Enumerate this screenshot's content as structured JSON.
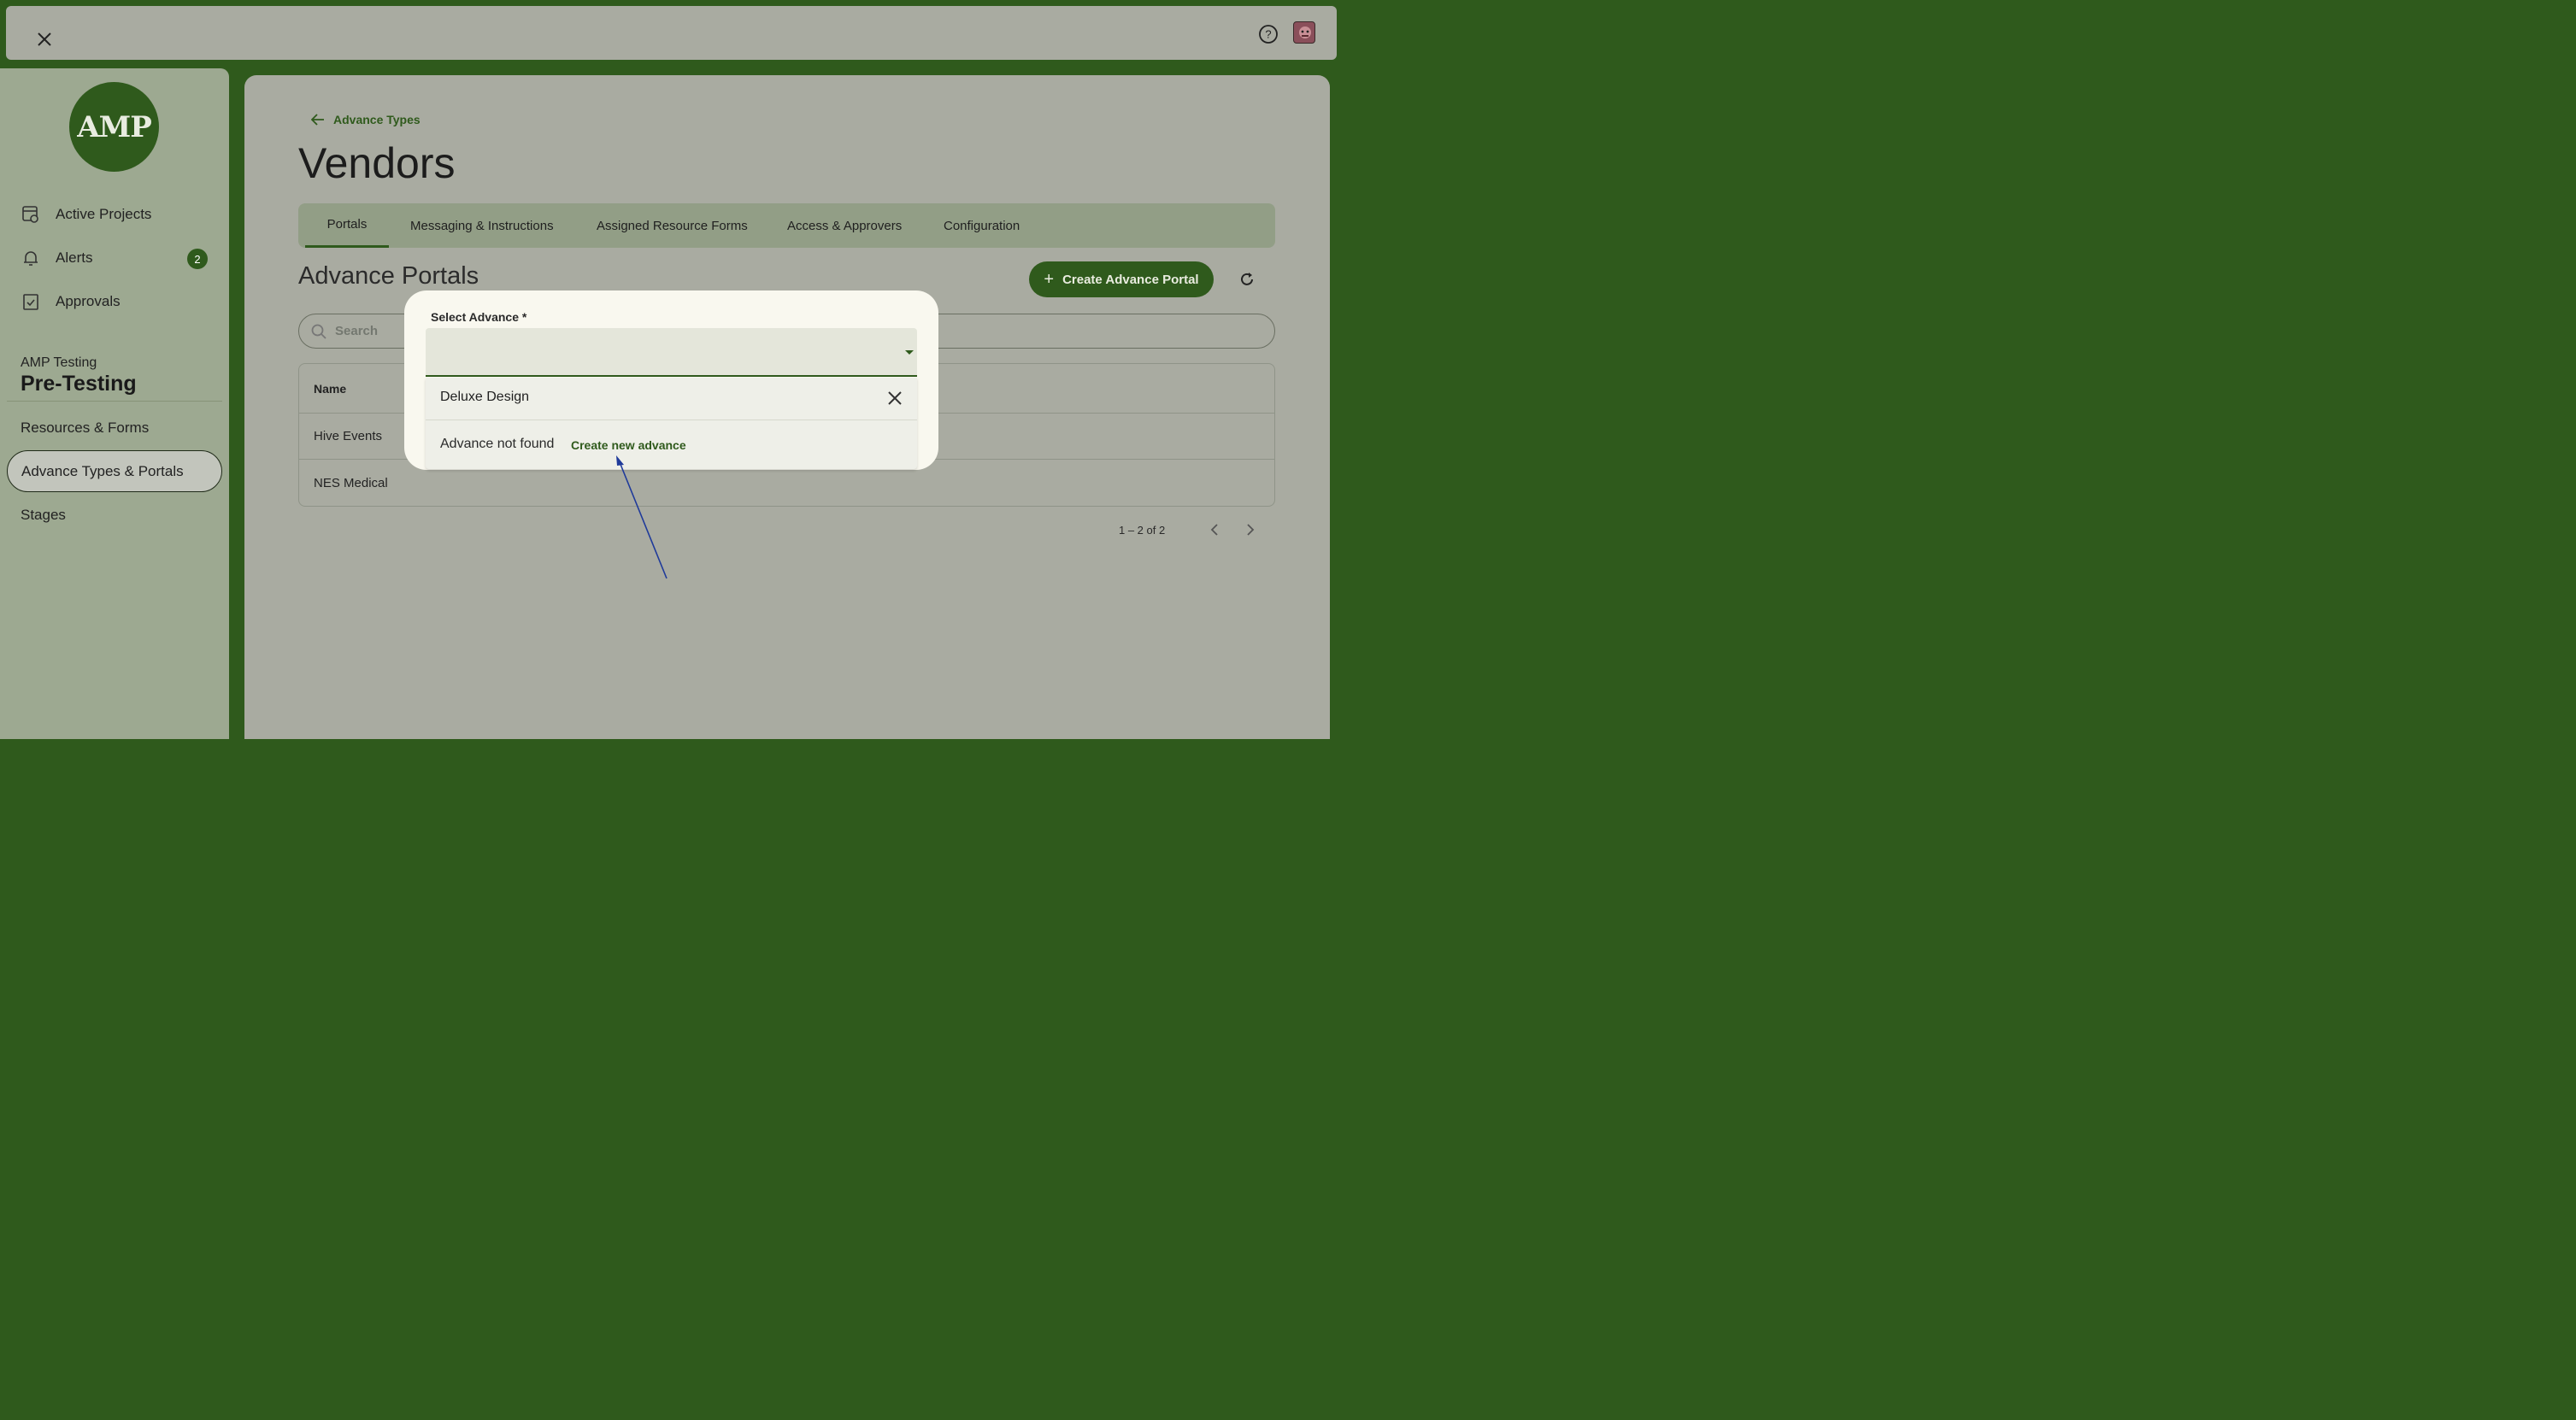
{
  "sidebar": {
    "logo_text": "AMP",
    "nav": [
      {
        "label": "Active Projects",
        "icon": "projects-icon"
      },
      {
        "label": "Alerts",
        "icon": "bell-icon",
        "badge": "2"
      },
      {
        "label": "Approvals",
        "icon": "clipboard-check-icon"
      }
    ],
    "org_small": "AMP Testing",
    "org_big": "Pre-Testing",
    "sub_items": [
      "Resources & Forms",
      "Advance Types & Portals",
      "Stages"
    ]
  },
  "main": {
    "back_label": "Advance Types",
    "title": "Vendors",
    "tabs": [
      "Portals",
      "Messaging & Instructions",
      "Assigned Resource Forms",
      "Access & Approvers",
      "Configuration"
    ],
    "section_title": "Advance Portals",
    "create_button": "Create Advance Portal",
    "search_placeholder": "Search",
    "table": {
      "header": "Name",
      "rows": [
        "Hive Events",
        "NES Medical"
      ]
    },
    "pagination": "1 – 2 of 2"
  },
  "modal": {
    "label": "Select Advance *",
    "search_value": "Deluxe Design",
    "not_found": "Advance not found",
    "create_link": "Create new advance"
  },
  "colors": {
    "brand_green": "#2f5a1c",
    "annotation_arrow": "#1f3a9a"
  }
}
